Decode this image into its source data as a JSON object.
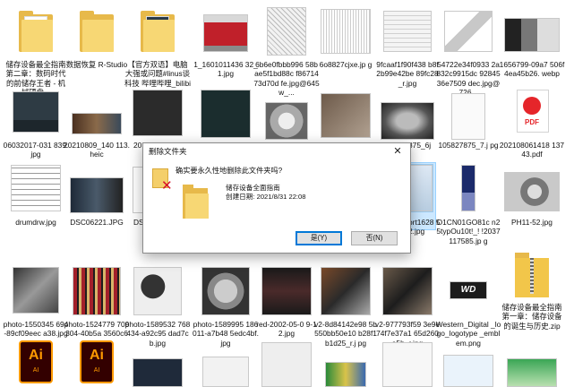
{
  "files": {
    "row1": [
      {
        "label": "储存设备最全指南第二章：数码时代的前储存王者 - 机械硬盘..."
      },
      {
        "label": "数据恢复 R-Studio"
      },
      {
        "label": "【官方双语】电脑大强或问题#linus谈科技 哔哩哔哩_bilibili ..."
      },
      {
        "label": "1_1601011436 32_1.jpg"
      },
      {
        "label": "6b6e0fbbb996 58bae5f1bd88c f8671473d70d fe.jpg@645w_..."
      },
      {
        "label": "6o8827cjxe.jp g"
      },
      {
        "label": "9fcaaf1f90f438 b8f2b99e42be 89fc28_r.jpg"
      },
      {
        "label": "54722e34f0933 2a832c9915dc 9284536e7509 dec.jpg@726..."
      },
      {
        "label": "1656799-09a7 506f4ea45b26. webp"
      }
    ],
    "row2": [
      {
        "label": "06032017-031 839.jpg"
      },
      {
        "label": "20210809_140 113.heic"
      },
      {
        "label": "20"
      },
      {
        "label": "875_6j"
      },
      {
        "label": "105827875_7.j pg"
      },
      {
        "label": "202108061418 13743.pdf"
      }
    ],
    "row3": [
      {
        "label": "drumdrw.jpg"
      },
      {
        "label": "DSC06221.JPG"
      },
      {
        "label": "DS"
      },
      {
        "label": "ort1628 52.jpg"
      },
      {
        "label": "O1CN01GO81c n25typOu10t!_! !2037117585.jp g"
      },
      {
        "label": "PH11-52.jpg"
      }
    ],
    "row4": [
      {
        "label": "photo-1550345 694-89cf09eec a38.jpg"
      },
      {
        "label": "photo-1524779 709304-40b5a 3560c60.jpg"
      },
      {
        "label": "photo-1589532 768434-a92c95 dad7cb.jpg"
      },
      {
        "label": "photo-1589995 186011-a7b48 5edc4bf.jpg"
      },
      {
        "label": "red-2002-05-0 9-12.jpg"
      },
      {
        "label": "v2-8d84142e98 5b550bb50e10 b28f1b1d25_r.j pg"
      },
      {
        "label": "v2-977793f59 3e9e74f7e37a1 65d260a5b_r.jpg"
      },
      {
        "label": "Western_Digital _logo_logotype _emblem.png"
      },
      {
        "label": "储存设备最全指南第一章：储存设备的诞生与历史.zip"
      }
    ],
    "row5": [
      {
        "label": "Ai"
      },
      {
        "label": "Ai"
      }
    ],
    "ai_sub": "AI",
    "pdf_label": "PDF"
  },
  "dialog": {
    "title": "删除文件夹",
    "close": "✕",
    "question": "确实要永久性地删除此文件夹吗?",
    "folder_name": "储存设备全面指南",
    "created": "创建日期: 2021/8/31 22:08",
    "yes": "是(Y)",
    "no": "否(N)"
  }
}
